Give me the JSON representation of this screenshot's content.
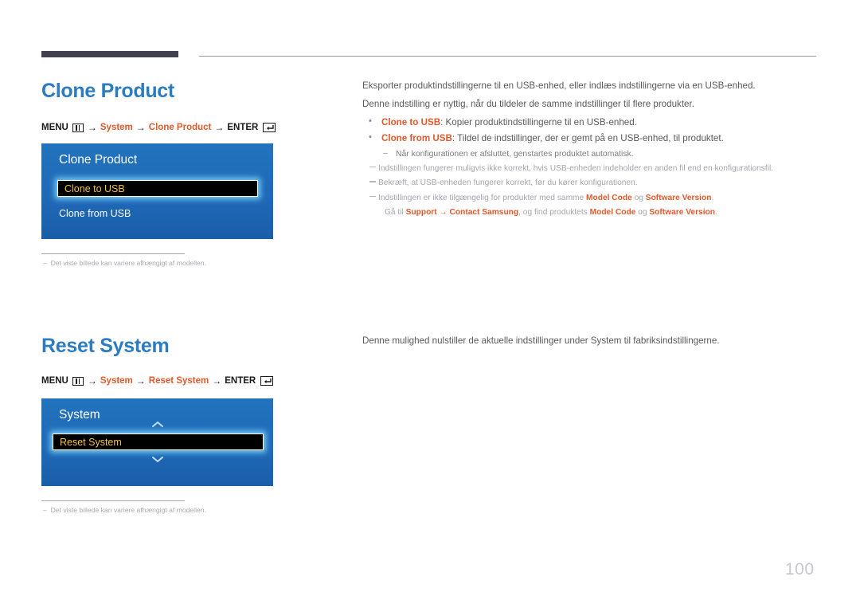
{
  "page": {
    "number": "100"
  },
  "sections": [
    {
      "title": "Clone Product",
      "menu_path": {
        "menu_label": "MENU",
        "menu_icon": "menu-icon",
        "arrow": "→",
        "step1": "System",
        "step2": "Clone Product",
        "enter_label": "ENTER",
        "enter_icon": "enter-icon"
      },
      "osd": {
        "title": "Clone Product",
        "rows": [
          {
            "label": "Clone to USB",
            "selected": true
          },
          {
            "label": "Clone from USB",
            "selected": false
          }
        ]
      },
      "footnote": "Det viste billede kan variere afhængigt af modellen.",
      "body": {
        "paragraphs": [
          "Eksporter produktindstillingerne til en USB-enhed, eller indlæs indstillingerne via en USB-enhed.",
          "Denne indstilling er nyttig, når du tildeler de samme indstillinger til flere produkter."
        ],
        "bullets": [
          {
            "term": "Clone to USB",
            "text": ": Kopier produktindstillingerne til en USB-enhed."
          },
          {
            "term": "Clone from USB",
            "text": ": Tildel de indstillinger, der er gemt på en USB-enhed, til produktet."
          }
        ],
        "dash_notes": [
          "Når konfigurationen er afsluttet, genstartes produktet automatisk."
        ],
        "notes": [
          {
            "text_before": "Indstillingen fungerer muligvis ikke korrekt, hvis USB-enheden indeholder en anden fil end en konfigurationsfil."
          },
          {
            "text_before": "Bekræft, at USB-enheden fungerer korrekt, før du kører konfigurationen."
          }
        ],
        "model_note": {
          "prefix": "Indstillingen er ikke tilgængelig for produkter med samme ",
          "term1": "Model Code",
          "mid": " og ",
          "term2": "Software Version",
          "suffix": ".",
          "sub_prefix": "Gå til ",
          "sub_term1": "Support",
          "sub_arrow": " → ",
          "sub_term2": "Contact Samsung",
          "sub_mid": ", og find produktets ",
          "sub_term3": "Model Code",
          "sub_mid2": " og ",
          "sub_term4": "Software Version",
          "sub_suffix": "."
        }
      }
    },
    {
      "title": "Reset System",
      "menu_path": {
        "menu_label": "MENU",
        "menu_icon": "menu-icon",
        "arrow": "→",
        "step1": "System",
        "step2": "Reset System",
        "enter_label": "ENTER",
        "enter_icon": "enter-icon"
      },
      "osd": {
        "title": "System",
        "chevron_up": "︿",
        "chevron_down": "﹀",
        "rows": [
          {
            "label": "Reset System",
            "selected": true
          }
        ]
      },
      "footnote": "Det viste billede kan variere afhængigt af modellen.",
      "body": {
        "paragraphs": [
          "Denne mulighed nulstiller de aktuelle indstillinger under System til fabriksindstillingerne."
        ]
      }
    }
  ],
  "colors": {
    "title_blue": "#2b7cc0",
    "accent_orange": "#e2582a",
    "osd_blue": "#1f69b8",
    "selected_text": "#f5c242",
    "top_bar": "#40404e"
  }
}
